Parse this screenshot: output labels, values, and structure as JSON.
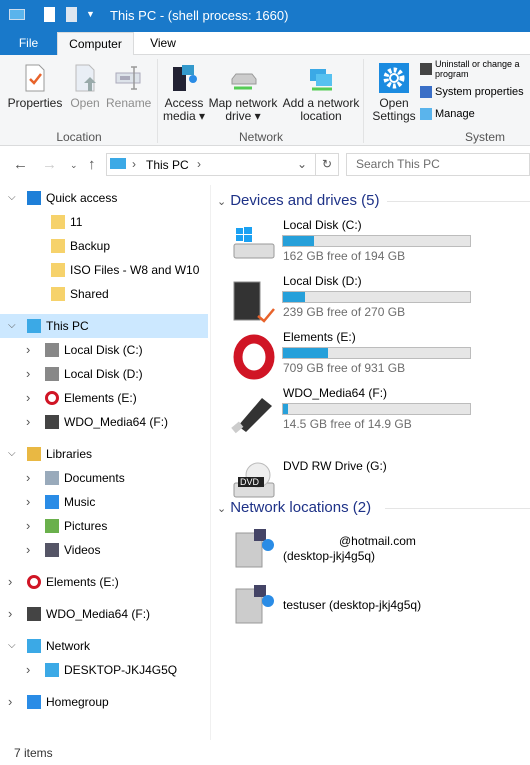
{
  "window": {
    "title": "This PC - (shell process: 1660)"
  },
  "tabs": [
    {
      "label": "File"
    },
    {
      "label": "Computer"
    },
    {
      "label": "View"
    }
  ],
  "ribbon": {
    "location": {
      "label": "Location",
      "buttons": [
        "Properties",
        "Open",
        "Rename"
      ]
    },
    "network": {
      "label": "Network",
      "access_media": "Access media",
      "map_drive": "Map network drive",
      "add_location": "Add a network location"
    },
    "system": {
      "label": "System",
      "open_settings": "Open Settings",
      "uninstall": "Uninstall or change a program",
      "sys_props": "System properties",
      "manage": "Manage"
    }
  },
  "address": {
    "path": "This PC",
    "search_placeholder": "Search This PC"
  },
  "nav": {
    "items": [
      {
        "label": "Quick access",
        "level": 0,
        "icon": "star-icon",
        "chev": "v"
      },
      {
        "label": "11",
        "level": 1,
        "icon": "folder-icon"
      },
      {
        "label": "Backup",
        "level": 1,
        "icon": "folder-icon"
      },
      {
        "label": "ISO Files - W8 and W10",
        "level": 1,
        "icon": "folder-icon"
      },
      {
        "label": "Shared",
        "level": 1,
        "icon": "folder-icon"
      },
      {
        "label": "This PC",
        "level": 0,
        "icon": "computer-icon",
        "chev": "v",
        "selected": true
      },
      {
        "label": "Local Disk (C:)",
        "level": 1,
        "icon": "drive-icon",
        "chev": ">"
      },
      {
        "label": "Local Disk (D:)",
        "level": 1,
        "icon": "drive-icon",
        "chev": ">"
      },
      {
        "label": "Elements (E:)",
        "level": 1,
        "icon": "opera-icon",
        "chev": ">"
      },
      {
        "label": "WDO_Media64 (F:)",
        "level": 1,
        "icon": "usb-icon",
        "chev": ">"
      },
      {
        "label": "Libraries",
        "level": 0,
        "icon": "libraries-icon",
        "chev": "v"
      },
      {
        "label": "Documents",
        "level": 1,
        "icon": "documents-icon",
        "chev": ">"
      },
      {
        "label": "Music",
        "level": 1,
        "icon": "music-icon",
        "chev": ">"
      },
      {
        "label": "Pictures",
        "level": 1,
        "icon": "pictures-icon",
        "chev": ">"
      },
      {
        "label": "Videos",
        "level": 1,
        "icon": "videos-icon",
        "chev": ">"
      },
      {
        "label": "Elements (E:)",
        "level": 0,
        "icon": "opera-icon",
        "chev": ">"
      },
      {
        "label": "WDO_Media64 (F:)",
        "level": 0,
        "icon": "usb-icon",
        "chev": ">"
      },
      {
        "label": "Network",
        "level": 0,
        "icon": "network-icon",
        "chev": "v"
      },
      {
        "label": "DESKTOP-JKJ4G5Q",
        "level": 1,
        "icon": "computer-icon",
        "chev": ">"
      },
      {
        "label": "Homegroup",
        "level": 0,
        "icon": "homegroup-icon",
        "chev": ">"
      }
    ]
  },
  "devices": {
    "header": "Devices and drives (5)",
    "drives": [
      {
        "name": "Local Disk (C:)",
        "free": "162 GB free of 194 GB",
        "used_fraction": 0.165,
        "icon": "windows-drive-icon"
      },
      {
        "name": "Local Disk (D:)",
        "free": "239 GB free of 270 GB",
        "used_fraction": 0.115,
        "icon": "server-drive-icon"
      },
      {
        "name": "Elements (E:)",
        "free": "709 GB free of 931 GB",
        "used_fraction": 0.238,
        "icon": "opera-icon"
      },
      {
        "name": "WDO_Media64 (F:)",
        "free": "14.5 GB free of 14.9 GB",
        "used_fraction": 0.027,
        "icon": "usb-icon"
      },
      {
        "name": "DVD RW Drive (G:)",
        "icon": "dvd-drive-icon"
      }
    ]
  },
  "network": {
    "header": "Network locations (2)",
    "items": [
      {
        "line1": "@hotmail.com",
        "line2": "(desktop-jkj4g5q)"
      },
      {
        "line1": "testuser (desktop-jkj4g5q)"
      }
    ]
  },
  "status": {
    "count": "7 items"
  },
  "colors": {
    "title_bar": "#1979ca",
    "selection": "#cce8ff",
    "progress": "#26a0da",
    "section_header": "#1e3287"
  }
}
